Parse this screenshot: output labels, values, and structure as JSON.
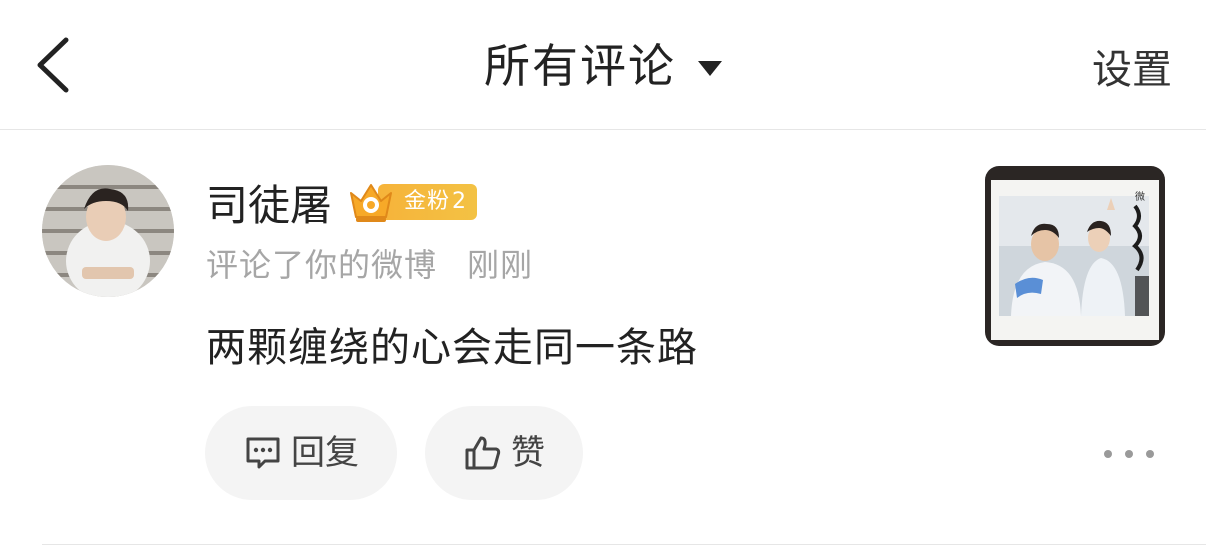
{
  "header": {
    "title": "所有评论",
    "settings_label": "设置",
    "back_icon": "chevron-left-icon",
    "dropdown_icon": "caret-down-icon"
  },
  "comment": {
    "username": "司徒屠",
    "fan_badge": {
      "label": "金粉",
      "level": "2",
      "color": "#f5b53b"
    },
    "action_text": "评论了你的微博",
    "time": "刚刚",
    "text": "两颗缠绕的心会走同一条路",
    "reply_label": "回复",
    "like_label": "赞"
  },
  "icons": {
    "reply": "comment-icon",
    "like": "thumbs-up-icon",
    "more": "more-dots-icon"
  }
}
